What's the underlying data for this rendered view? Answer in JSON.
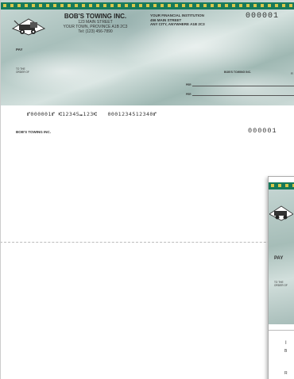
{
  "cheque": {
    "company": {
      "name": "BOB'S TOWING INC.",
      "address_line1": "123 MAIN STREET",
      "address_line2": "YOUR TOWN, PROVINCE A1B 2C3",
      "phone": "Tel: (123) 456-7890"
    },
    "bank": {
      "line1": "YOUR FINANCIAL INSTITUTION",
      "line2": "456 MAIN STREET",
      "line3": "ANY CITY, ANYWHERE A1B 2C3"
    },
    "cheque_number": "000001",
    "pay_label": "PAY",
    "to_the_order_of": "TO THE ORDER OF",
    "payer_company": "BOB'S TOWING INC.",
    "per_label_1": "PER",
    "per_label_2": "PER",
    "edge_letter": "R",
    "micr_line": "⑈000001⑈ ⑆12345⑉123⑆   0001234512340⑈"
  },
  "stub": {
    "company": "BOB'S TOWING INC.",
    "cheque_number": "000001"
  },
  "second_sheet": {
    "pay_label": "PAY",
    "to_the_order_of": "TO THE ORDER OF",
    "stub_line_a": "I",
    "stub_line_b": "B",
    "stub_line_c": "R"
  },
  "colors": {
    "band": "#177a5b",
    "band_dots": "#d9c74a",
    "background_pattern": "#a8bfbb"
  },
  "icons": {
    "logo": "tow-truck-icon"
  }
}
